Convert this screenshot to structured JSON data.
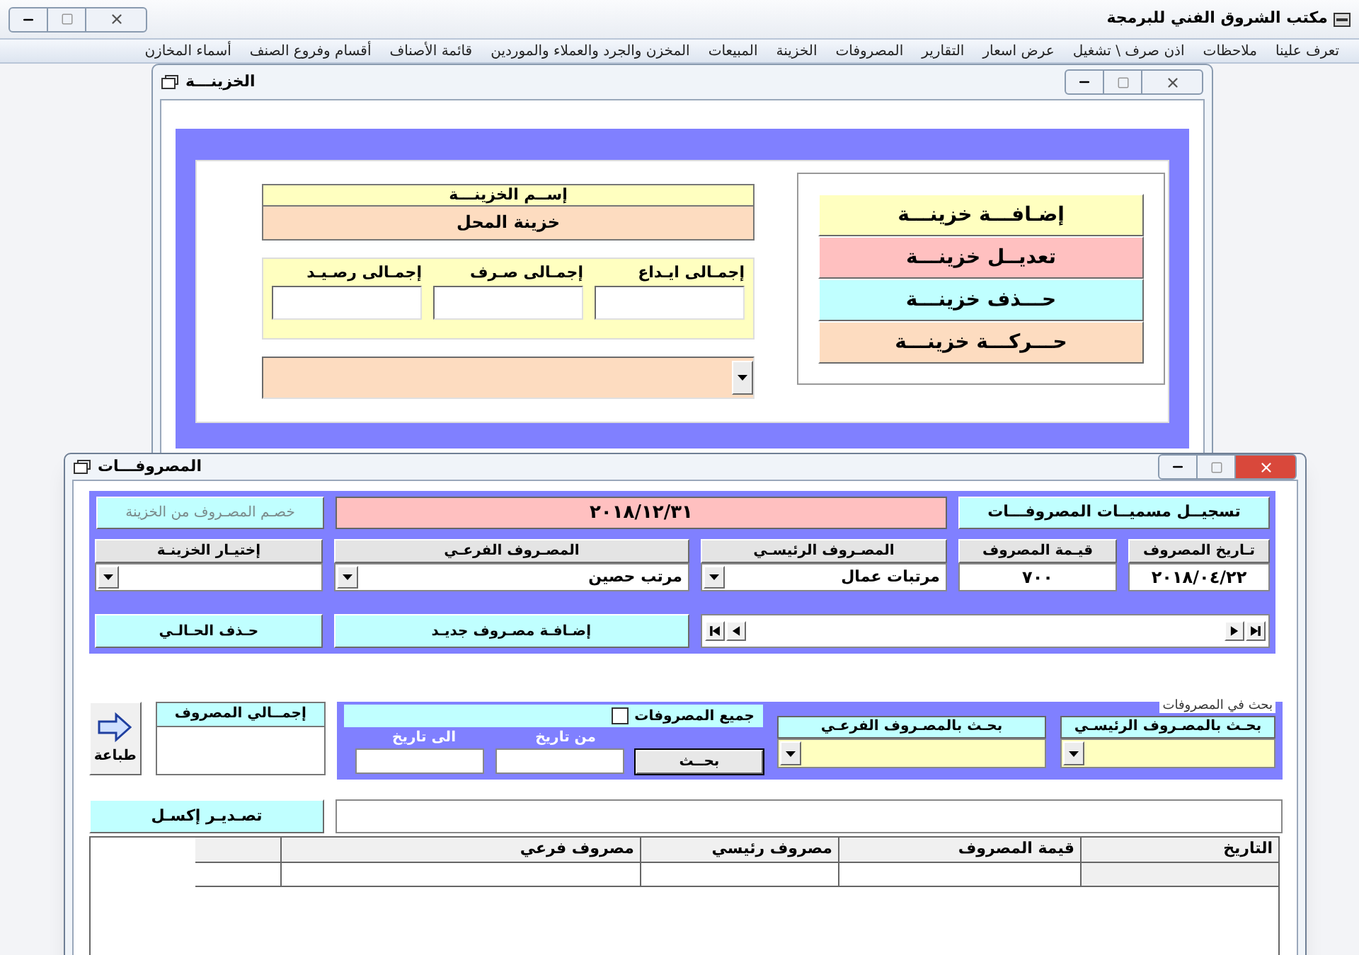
{
  "app": {
    "title": "مكتب الشروق الفني للبرمجة",
    "menu": [
      "تعرف علينا",
      "ملاحظات",
      "اذن صرف \\ تشغيل",
      "عرض اسعار",
      "التقارير",
      "المصروفات",
      "الخزينة",
      "المبيعات",
      "المخزن والجرد والعملاء والموردين",
      "قائمة الأصناف",
      "أقسام وفروع الصنف",
      "أسماء المخازن"
    ]
  },
  "treasury_window": {
    "title": "الخزينـــة",
    "actions": [
      {
        "label": "إضـافـــة خزينـــة",
        "color": "#ffffc0"
      },
      {
        "label": "تعديــل خزينـــة",
        "color": "#ffc0c0"
      },
      {
        "label": "حـــذف خزينـــة",
        "color": "#c0ffff"
      },
      {
        "label": "حـــركـــة خزينـــة",
        "color": "#fddcc0"
      }
    ],
    "name_label": "إســم الخزينـــة",
    "name_value": "خزينة المحل",
    "totals": [
      {
        "label": "إجمـالى ايـداع"
      },
      {
        "label": "إجمـالى صـرف"
      },
      {
        "label": "إجمـالى رصـيـد"
      }
    ]
  },
  "expenses_window": {
    "title": "المصروفـــات",
    "register_button": "تسجيــل مسميــات المصروفـــات",
    "date_banner": "٢٠١٨/١٢/٣١",
    "deduct_button": {
      "label": "خصـم المصـروف من الخزينة",
      "disabled": true
    },
    "fields": [
      {
        "kind": "text",
        "label": "تـاريخ المصروف",
        "value": "٢٠١٨/٠٤/٢٢"
      },
      {
        "kind": "text",
        "label": "قيـمة المصروف",
        "value": "٧٠٠"
      },
      {
        "kind": "dropdown",
        "label": "المصـروف الرئيسـي",
        "value": "مرتبات عمال"
      },
      {
        "kind": "dropdown",
        "label": "المصـروف الفرعـي",
        "value": "مرتب حصين"
      },
      {
        "kind": "dropdown",
        "label": "إختيـار الخزينـة"
      }
    ],
    "add_button": "إضـافـة مصـروف جديـد",
    "delete_button": "حـذف الحـالـي",
    "search": {
      "title": "بحث في المصروفات",
      "filters": [
        {
          "label": "بحـث بالمصـروف الرئيسـي"
        },
        {
          "label": "بحـث بالمصـروف الفرعـي"
        }
      ],
      "all_checkbox": {
        "label": "جميع المصروفات",
        "checked": false
      },
      "from_label": "من تاريخ",
      "to_label": "الى تاريخ",
      "search_button": "بحــث"
    },
    "total_label": "إجمــالي المصروف",
    "print_button": "طباعة",
    "export_button": "تصـديـر إكسـل",
    "table": {
      "columns": [
        "التاريخ",
        "قيمة المصروف",
        "مصروف رئيسي",
        "مصروف فرعي"
      ]
    }
  }
}
